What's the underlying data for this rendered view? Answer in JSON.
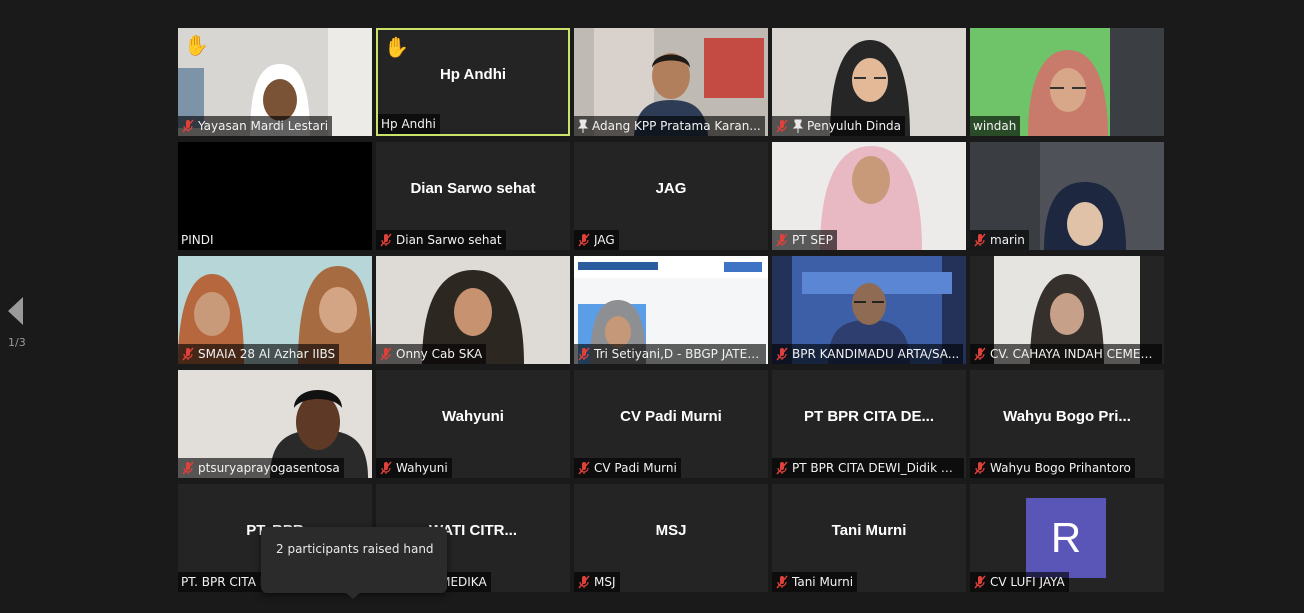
{
  "navigation": {
    "page_indicator": "1/3"
  },
  "tooltip": {
    "text": "2 participants raised hand"
  },
  "colors": {
    "background": "#1a1a1a",
    "tile": "#242424",
    "active_speaker": "#c9e36b",
    "avatar": "#5a56b8",
    "muted_mic": "#e0403a"
  },
  "participants": [
    {
      "label": "Yayasan Mardi Lestari",
      "muted": true,
      "hand_raised": true,
      "video": true
    },
    {
      "label": "Hp Andhi",
      "center_name": "Hp Andhi",
      "muted": false,
      "hand_raised": true,
      "active_speaker": true
    },
    {
      "label": "Adang KPP Pratama Karan...",
      "pinned": true,
      "video": true
    },
    {
      "label": "Penyuluh Dinda",
      "muted": true,
      "pinned": true,
      "video": true
    },
    {
      "label": "windah",
      "video": true
    },
    {
      "label": "PINDI",
      "video": false
    },
    {
      "label": "Dian Sarwo sehat",
      "center_name": "Dian Sarwo sehat",
      "muted": true
    },
    {
      "label": "JAG",
      "center_name": "JAG",
      "muted": true
    },
    {
      "label": "PT SEP",
      "muted": true,
      "video": true
    },
    {
      "label": "marin",
      "muted": true,
      "video": true
    },
    {
      "label": "SMAIA 28 Al Azhar IIBS",
      "muted": true,
      "video": true
    },
    {
      "label": "Onny Cab SKA",
      "muted": true,
      "video": true
    },
    {
      "label": "Tri Setiyani,D - BBGP JATENG",
      "muted": true,
      "video": true
    },
    {
      "label": "BPR KANDIMADU ARTA/SA...",
      "muted": true,
      "video": true
    },
    {
      "label": "CV. CAHAYA INDAH CEMER...",
      "muted": true,
      "video": true
    },
    {
      "label": "ptsuryaprayogasentosa",
      "muted": true,
      "video": true
    },
    {
      "label": "Wahyuni",
      "center_name": "Wahyuni",
      "muted": true
    },
    {
      "label": "CV Padi Murni",
      "center_name": "CV Padi Murni",
      "muted": true
    },
    {
      "label": "PT BPR CITA DEWI_Didik Ha...",
      "center_name": "PT BPR CITA DE...",
      "muted": true
    },
    {
      "label": "Wahyu Bogo Prihantoro",
      "center_name": "Wahyu Bogo Pri...",
      "muted": true
    },
    {
      "label": "PT. BPR CITA I",
      "center_name": "PT. BPR"
    },
    {
      "label": "ATI CITRA MEDIKA",
      "center_name": "WATI CITR..."
    },
    {
      "label": "MSJ",
      "center_name": "MSJ",
      "muted": true
    },
    {
      "label": "Tani Murni",
      "center_name": "Tani Murni",
      "muted": true
    },
    {
      "label": "CV LUFI JAYA",
      "avatar_letter": "R",
      "muted": true
    }
  ]
}
